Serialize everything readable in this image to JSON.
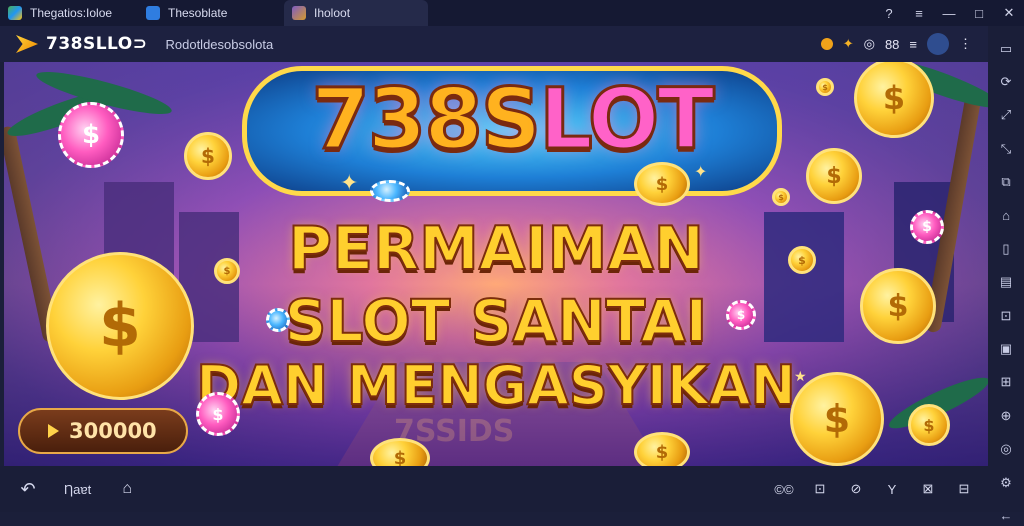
{
  "window": {
    "tabs": [
      {
        "label": "Thegatios:Ioloe"
      },
      {
        "label": "Thesoblate"
      },
      {
        "label": "Iholoot"
      }
    ],
    "controls": [
      "?",
      "≡",
      "—",
      "□",
      "✕"
    ]
  },
  "header": {
    "title": "738SLLO⊃",
    "url": "Rodotldesobsolota",
    "icon_glyphs": [
      "◉",
      "✦",
      "◎",
      "88",
      "≡",
      "●",
      "⋮"
    ]
  },
  "banner": {
    "logo_left": "738S",
    "logo_right": "LOT",
    "line1": "PERMAIMAN",
    "line2": "SLOT SANTAI",
    "line3": "DAN MENGASYIKAN",
    "watermark": "7SSIDS",
    "balance": "300000",
    "coin_symbol": "$"
  },
  "sidebar": {
    "icons": [
      "gamepad-icon",
      "rotate-icon",
      "expand-icon",
      "shrink-icon",
      "copy-icon",
      "folder-icon",
      "phone-icon",
      "apk-icon",
      "screenshot-icon",
      "record-icon",
      "camera-icon",
      "shake-icon",
      "location-icon",
      "settings-icon",
      "back-icon"
    ]
  },
  "bottom": {
    "back": "↶",
    "home_label": "Ƞaɐt",
    "recents": "⌂",
    "right_icons": [
      "©©",
      "⊡",
      "⊘",
      "Y",
      "⊠",
      "⊟"
    ]
  },
  "colors": {
    "bg": "#1b1f3a",
    "gold": "#ffcf2e",
    "pink": "#ff62c8",
    "blue": "#1e7fd6"
  }
}
